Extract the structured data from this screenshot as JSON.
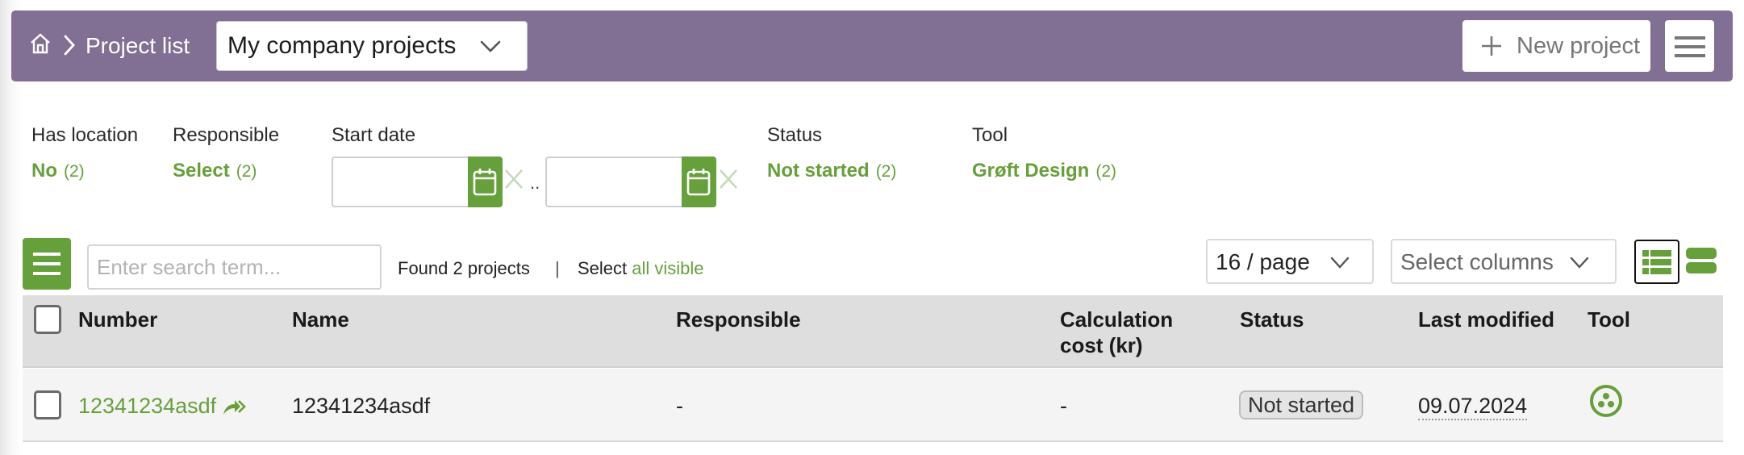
{
  "header": {
    "home_icon": "home-icon",
    "breadcrumb_separator_icon": "chevron-right-icon",
    "breadcrumb": "Project list",
    "scope_select": {
      "value": "My company projects",
      "icon": "chevron-down-icon"
    },
    "new_project_label": "New project",
    "new_project_icon": "plus-icon",
    "menu_icon": "hamburger-icon"
  },
  "filters": {
    "has_location": {
      "label": "Has location",
      "value": "No",
      "count": "(2)"
    },
    "responsible": {
      "label": "Responsible",
      "value": "Select",
      "count": "(2)"
    },
    "start_date": {
      "label": "Start date",
      "from_value": "",
      "to_value": "",
      "range_separator": ".."
    },
    "status": {
      "label": "Status",
      "value": "Not started",
      "count": "(2)"
    },
    "tool": {
      "label": "Tool",
      "value": "Grøft Design",
      "count": "(2)"
    }
  },
  "toolbar": {
    "search_placeholder": "Enter search term...",
    "search_value": "",
    "found_text": "Found 2 projects",
    "separator": "|",
    "select_prefix": "Select",
    "select_link": "all visible",
    "page_size": "16 / page",
    "columns_placeholder": "Select columns",
    "view_modes": [
      "list-view",
      "card-view"
    ],
    "active_view": "list-view"
  },
  "table": {
    "columns": [
      "Number",
      "Name",
      "Responsible",
      "Calculation cost (kr)",
      "Status",
      "Last modified",
      "Tool"
    ],
    "calc_col_line1": "Calculation",
    "calc_col_line2": "cost (kr)",
    "rows": [
      {
        "number": "12341234asdf",
        "name": "12341234asdf",
        "responsible": "-",
        "calculation_cost": "-",
        "status": "Not started",
        "last_modified": "09.07.2024",
        "tool_icon": "groft-design-icon"
      }
    ]
  },
  "colors": {
    "header_bg": "#826f94",
    "accent_green": "#66a03a",
    "table_header_bg": "#dedede",
    "row_bg": "#f4f4f4"
  }
}
